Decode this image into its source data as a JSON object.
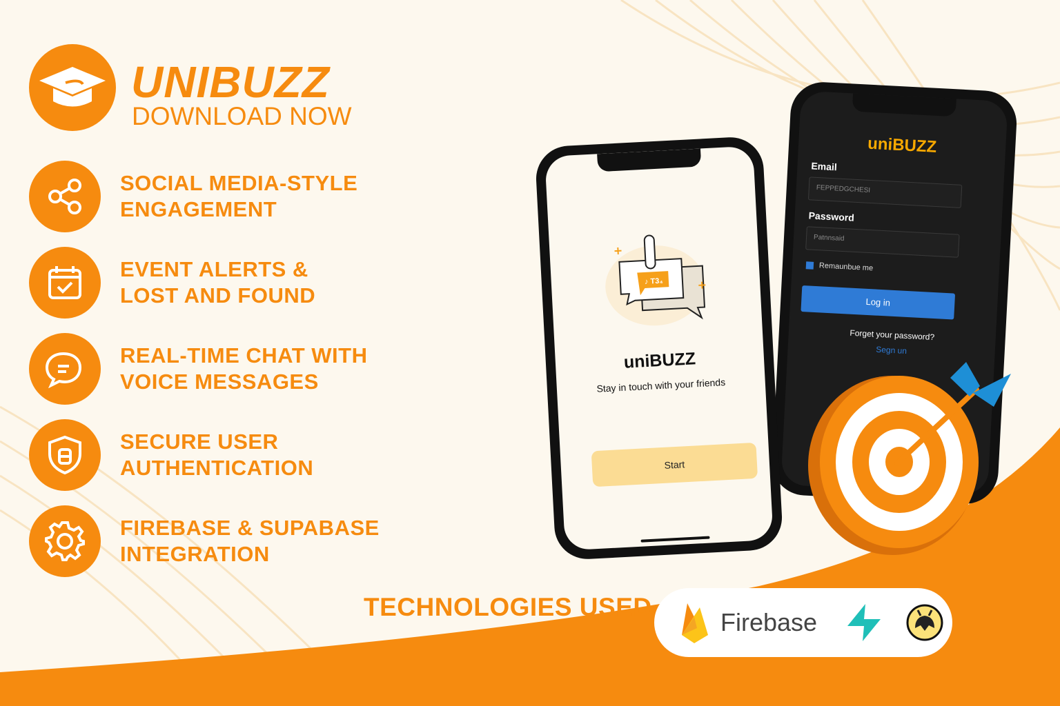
{
  "brand": {
    "title": "UNIBUZZ",
    "subtitle": "DOWNLOAD NOW"
  },
  "features": [
    {
      "icon": "share-icon",
      "line1": "SOCIAL MEDIA-STYLE",
      "line2": "ENGAGEMENT"
    },
    {
      "icon": "calendar-check-icon",
      "line1": "EVENT ALERTS &",
      "line2": "LOST AND FOUND"
    },
    {
      "icon": "chat-bubble-icon",
      "line1": "REAL-TIME CHAT WITH",
      "line2": "VOICE MESSAGES"
    },
    {
      "icon": "shield-icon",
      "line1": "SECURE USER",
      "line2": "AUTHENTICATION"
    },
    {
      "icon": "gear-icon",
      "line1": "FIREBASE & SUPABASE",
      "line2": "INTEGRATION"
    }
  ],
  "welcome_phone": {
    "app_name": "uniBUZZ",
    "tagline": "Stay in touch with your friends",
    "bubble_text": "♪ T3₄",
    "start_label": "Start"
  },
  "login_phone": {
    "app_name": "uniBUZZ",
    "email_label": "Email",
    "email_value": "FEPPEDGCHESI",
    "password_label": "Password",
    "password_value": "Patnnsaid",
    "remember_label": "Remaunbue me",
    "login_label": "Log in",
    "forgot_label": "Forget your password?",
    "signup_label": "Segn un"
  },
  "technologies": {
    "label": "TECHNOLOGIES USED",
    "firebase": "Firebase"
  },
  "colors": {
    "orange": "#f68b0f",
    "cream": "#fdf8ee",
    "blue": "#2f7bd6",
    "teal": "#1fbfb8"
  }
}
